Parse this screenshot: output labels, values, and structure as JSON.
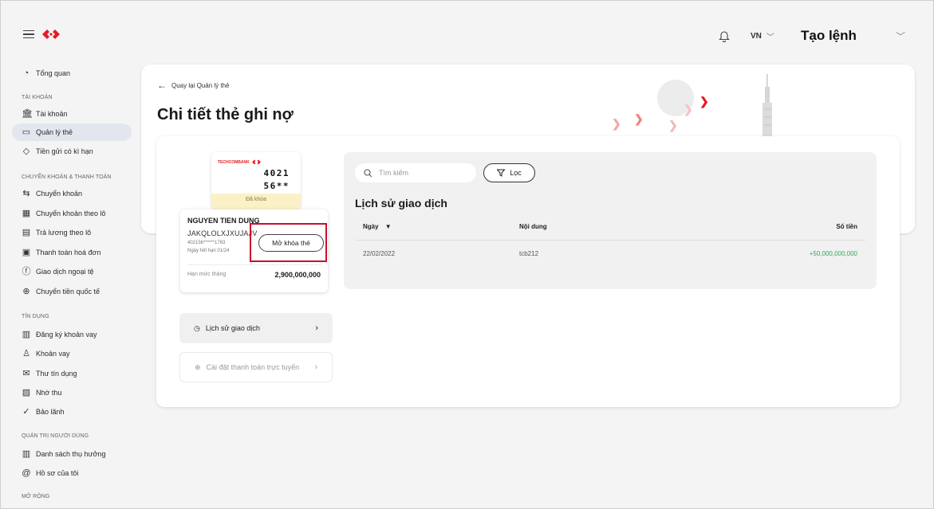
{
  "header": {
    "lang": "VN",
    "create_order": "Tạo lệnh"
  },
  "sidebar": {
    "sections": {
      "account": "TÀI KHOẢN",
      "transfer": "CHUYỂN KHOẢN & THANH TOÁN",
      "credit": "TÍN DỤNG",
      "admin": "QUẢN TRỊ NGƯỜI DÙNG",
      "extend": "MỞ RỘNG"
    },
    "items": [
      {
        "label": "Tổng quan",
        "icon": "dashboard-icon"
      },
      {
        "label": "Tài khoản",
        "icon": "bank-icon"
      },
      {
        "label": "Quản lý thẻ",
        "icon": "card-icon",
        "active": true
      },
      {
        "label": "Tiền gửi có kì hạn",
        "icon": "deposit-icon"
      },
      {
        "label": "Chuyển khoản",
        "icon": "transfer-icon"
      },
      {
        "label": "Chuyển khoản theo lô",
        "icon": "batch-transfer-icon"
      },
      {
        "label": "Trả lương theo lô",
        "icon": "payroll-icon"
      },
      {
        "label": "Thanh toán hoá đơn",
        "icon": "bill-icon"
      },
      {
        "label": "Giao dịch ngoại tệ",
        "icon": "fx-icon"
      },
      {
        "label": "Chuyển tiền quốc tế",
        "icon": "globe-icon"
      },
      {
        "label": "Đăng ký khoản vay",
        "icon": "loan-register-icon"
      },
      {
        "label": "Khoản vay",
        "icon": "loan-icon"
      },
      {
        "label": "Thư tín dụng",
        "icon": "letter-icon"
      },
      {
        "label": "Nhờ thu",
        "icon": "collection-icon"
      },
      {
        "label": "Bảo lãnh",
        "icon": "guarantee-icon"
      },
      {
        "label": "Danh sách thụ hưởng",
        "icon": "beneficiary-icon"
      },
      {
        "label": "Hồ sơ của tôi",
        "icon": "profile-icon"
      }
    ]
  },
  "page": {
    "back": "Quay lại Quản lý thẻ",
    "title": "Chi tiết thẻ ghi nợ"
  },
  "card": {
    "bank": "TECHCOMBANK",
    "num_line1": "4021",
    "num_line2": "56**",
    "status": "Đã khóa",
    "holder": "NGUYEN TIEN DUNG",
    "holder_sub": "JAKQLOLXJXUJAJV",
    "masked": "402156******1763",
    "expiry": "Ngày hết hạn 01/24",
    "unlock": "Mở khóa thẻ",
    "limit_label": "Hạn mức tháng",
    "limit_value": "2,900,000,000"
  },
  "menu": {
    "history": "Lịch sử giao dịch",
    "online_settings": "Cài đặt thanh toán trực tuyến"
  },
  "transactions": {
    "search_placeholder": "Tìm kiếm",
    "filter": "Lọc",
    "title": "Lịch sử giao dịch",
    "columns": [
      "Ngày",
      "Nội dung",
      "Số tiền"
    ],
    "rows": [
      {
        "date": "22/02/2022",
        "content": "tcb212",
        "amount": "+50,000,000,000"
      }
    ]
  },
  "colors": {
    "brand_red": "#e31b23",
    "amount_green": "#3aa65b",
    "active_bg": "#e2e6ee"
  }
}
